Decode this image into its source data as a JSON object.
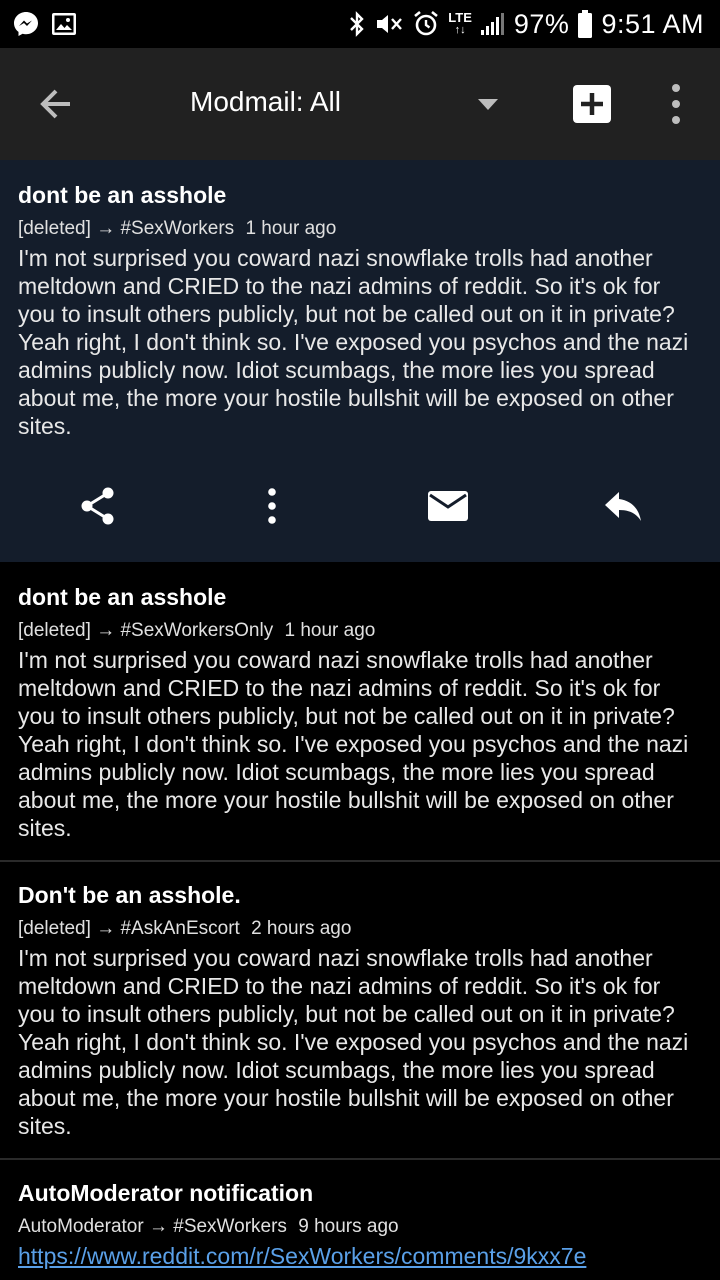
{
  "status_bar": {
    "icons_left": [
      "messenger-icon",
      "gallery-icon"
    ],
    "icons_right": [
      "bluetooth-icon",
      "mute-icon",
      "alarm-icon",
      "lte-icon",
      "signal-icon"
    ],
    "lte": "LTE",
    "battery": "97%",
    "time": "9:51 AM"
  },
  "app_bar": {
    "title": "Modmail: All",
    "icons": [
      "back-arrow-icon",
      "dropdown-icon",
      "add-icon",
      "more-vert-icon"
    ]
  },
  "messages": [
    {
      "title": "dont be an asshole",
      "from": "[deleted]",
      "arrow": "→",
      "to": "#SexWorkers",
      "time": "1 hour ago",
      "body": "I'm not surprised you coward nazi snowflake trolls had another meltdown and CRIED to the nazi admins of reddit. So it's ok for you to insult others publicly, but not be called out on it in private? Yeah right, I don't think so. I've exposed you psychos and the nazi admins publicly now. Idiot scumbags, the more lies you spread about me, the more your hostile bullshit will be exposed on other sites.",
      "selected": true
    },
    {
      "title": "dont be an asshole",
      "from": "[deleted]",
      "arrow": "→",
      "to": "#SexWorkersOnly",
      "time": "1 hour ago",
      "body": "I'm not surprised you coward nazi snowflake trolls had another meltdown and CRIED to the nazi admins of reddit. So it's ok for you to insult others publicly, but not be called out on it in private? Yeah right, I don't think so. I've exposed you psychos and the nazi admins publicly now. Idiot scumbags, the more lies you spread about me, the more your hostile bullshit will be exposed on other sites."
    },
    {
      "title": "Don't be an asshole.",
      "from": "[deleted]",
      "arrow": "→",
      "to": "#AskAnEscort",
      "time": "2 hours ago",
      "body": "I'm not surprised you coward nazi snowflake trolls had another meltdown and CRIED to the nazi admins of reddit. So it's ok for you to insult others publicly, but not be called out on it in private? Yeah right, I don't think so. I've exposed you psychos and the nazi admins publicly now. Idiot scumbags, the more lies you spread about me, the more your hostile bullshit will be exposed on other sites."
    },
    {
      "title": "AutoModerator notification",
      "from": "AutoModerator",
      "arrow": "→",
      "to": "#SexWorkers",
      "time": "9 hours ago",
      "link": "https://www.reddit.com/r/SexWorkers/comments/9kxx7e"
    }
  ],
  "selected_actions": [
    "share-icon",
    "more-vert-icon",
    "mail-icon",
    "reply-icon"
  ],
  "colors": {
    "background": "#000000",
    "app_bar": "#212121",
    "selected_bg": "#141d2b",
    "link": "#5aa0e8"
  }
}
